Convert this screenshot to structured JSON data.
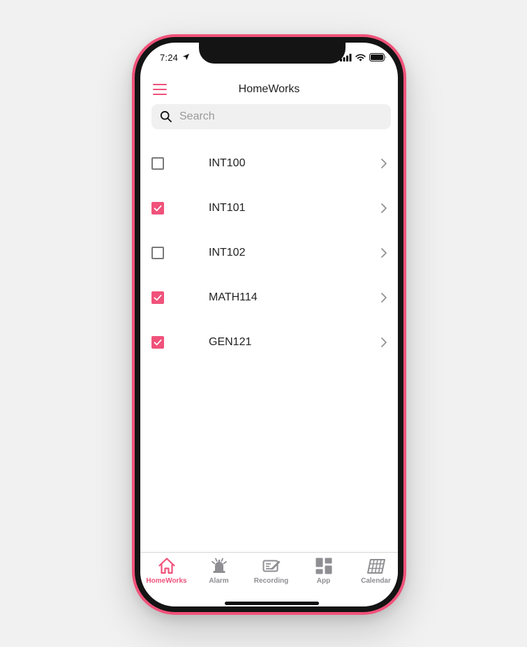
{
  "status_bar": {
    "time": "7:24"
  },
  "header": {
    "title": "HomeWorks"
  },
  "search": {
    "placeholder": "Search",
    "value": ""
  },
  "homeworks": [
    {
      "label": "INT100",
      "checked": false
    },
    {
      "label": "INT101",
      "checked": true
    },
    {
      "label": "INT102",
      "checked": false
    },
    {
      "label": "MATH114",
      "checked": true
    },
    {
      "label": "GEN121",
      "checked": true
    }
  ],
  "tabs": [
    {
      "label": "HomeWorks",
      "icon": "home-icon",
      "active": true
    },
    {
      "label": "Alarm",
      "icon": "alarm-bell-icon",
      "active": false
    },
    {
      "label": "Recording",
      "icon": "recording-icon",
      "active": false
    },
    {
      "label": "App",
      "icon": "app-grid-icon",
      "active": false
    },
    {
      "label": "Calendar",
      "icon": "calendar-icon",
      "active": false
    }
  ],
  "colors": {
    "accent": "#f0527a",
    "inactive": "#8e8e93",
    "background": "#f1f1f1",
    "search_bg": "#f0f0f0"
  }
}
